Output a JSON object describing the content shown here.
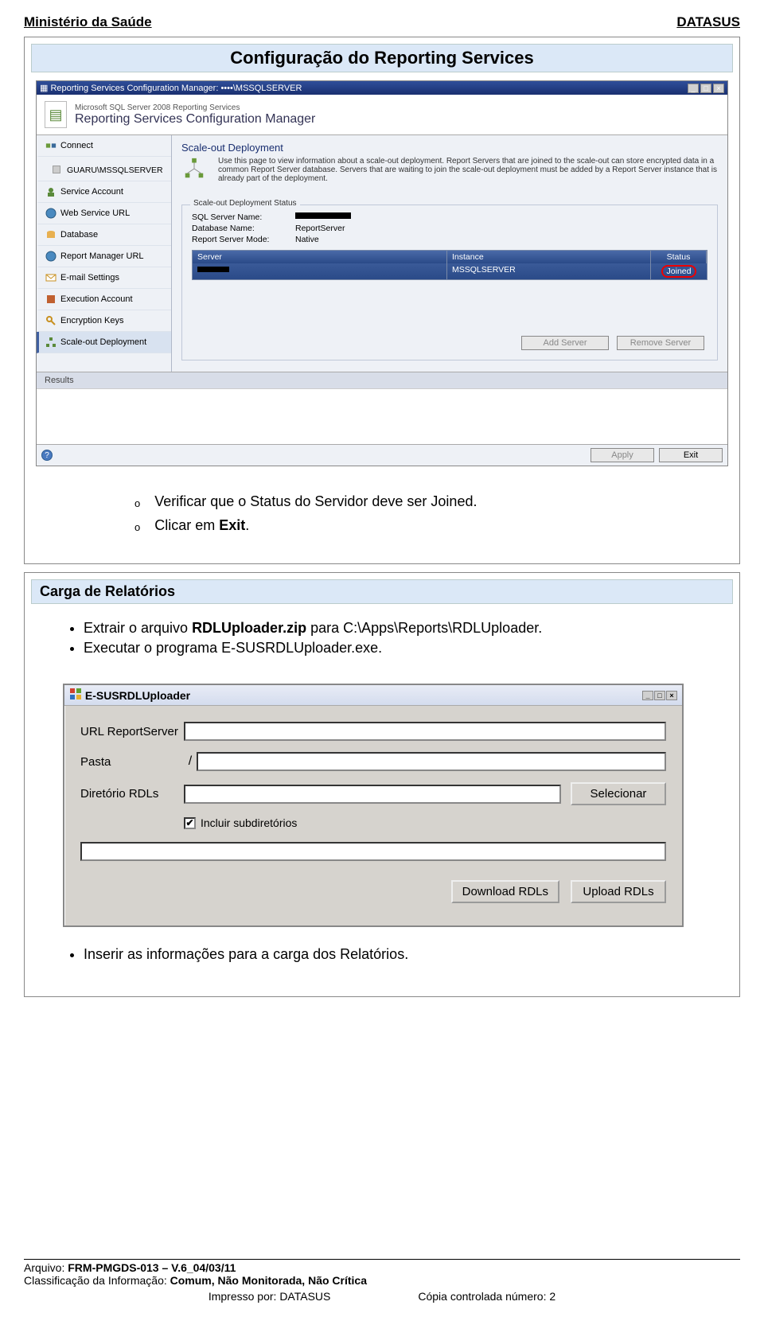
{
  "header": {
    "left": "Ministério da Saúde",
    "right": "DATASUS"
  },
  "section1_title": "Configuração do Reporting Services",
  "rs": {
    "title": "Reporting Services Configuration Manager: ••••\\MSSQLSERVER",
    "sub1": "Microsoft SQL Server 2008 Reporting Services",
    "sub2": "Reporting Services Configuration Manager",
    "connect": "Connect",
    "instance": "GUARU\\MSSQLSERVER",
    "nav": [
      "Service Account",
      "Web Service URL",
      "Database",
      "Report Manager URL",
      "E-mail Settings",
      "Execution Account",
      "Encryption Keys",
      "Scale-out Deployment"
    ],
    "main_title": "Scale-out Deployment",
    "main_desc": "Use this page to view information about a scale-out deployment. Report Servers that are joined to the scale-out can store encrypted data in a common Report Server database. Servers that are waiting to join the scale-out deployment must be added by a Report Server instance that is already part of the deployment.",
    "fieldset_legend": "Scale-out Deployment Status",
    "status": {
      "k1": "SQL Server Name:",
      "v1": "",
      "k2": "Database Name:",
      "v2": "ReportServer",
      "k3": "Report Server Mode:",
      "v3": "Native"
    },
    "table": {
      "h1": "Server",
      "h2": "Instance",
      "h3": "Status",
      "r1c2": "MSSQLSERVER",
      "r1c3": "Joined"
    },
    "btn_add": "Add Server",
    "btn_remove": "Remove Server",
    "results_label": "Results",
    "btn_apply": "Apply",
    "btn_exit": "Exit"
  },
  "instr1a": "Verificar que o Status do Servidor deve ser Joined.",
  "instr1b_pre": "Clicar em ",
  "instr1b_bold": "Exit",
  "instr1b_post": ".",
  "section2_title": "Carga de Relatórios",
  "instr2a_pre": "Extrair o arquivo ",
  "instr2a_bold": "RDLUploader.zip",
  "instr2a_post": " para C:\\Apps\\Reports\\RDLUploader.",
  "instr2b": "Executar o programa E-SUSRDLUploader.exe.",
  "uploader": {
    "title": "E-SUSRDLUploader",
    "url_label": "URL ReportServer",
    "pasta_label": "Pasta",
    "pasta_prefix": "/",
    "dir_label": "Diretório RDLs",
    "select_btn": "Selecionar",
    "checkbox_label": "Incluir subdiretórios",
    "download_btn": "Download RDLs",
    "upload_btn": "Upload RDLs"
  },
  "instr3": "Inserir as informações para a carga dos Relatórios.",
  "footer": {
    "l1_pre": "Arquivo: ",
    "l1_bold": "FRM-PMGDS-013 – V.6_04/03/11",
    "l2_pre": "Classificação da Informação: ",
    "l2_bold": "Comum, Não Monitorada, Não Crítica",
    "l3a": "Impresso por: DATASUS",
    "l3b": "Cópia controlada número: 2"
  }
}
